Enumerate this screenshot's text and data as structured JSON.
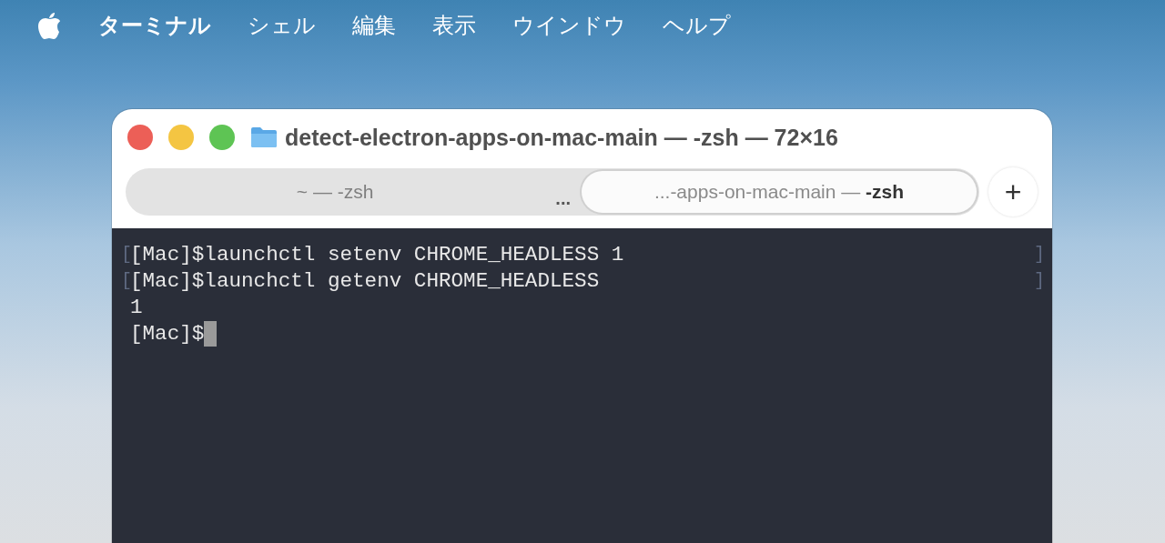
{
  "menu_bar": {
    "items": [
      {
        "label": "ターミナル",
        "bold": true
      },
      {
        "label": "シェル",
        "bold": false
      },
      {
        "label": "編集",
        "bold": false
      },
      {
        "label": "表示",
        "bold": false
      },
      {
        "label": "ウインドウ",
        "bold": false
      },
      {
        "label": "ヘルプ",
        "bold": false
      }
    ]
  },
  "window": {
    "title": "detect-electron-apps-on-mac-main — -zsh — 72×16",
    "tabs": [
      {
        "label": "~ — -zsh",
        "selected": false
      },
      {
        "label": "...-apps-on-mac-main — ",
        "bold_part": "-zsh",
        "selected": true
      }
    ],
    "tab_overflow": "...",
    "new_tab": "+"
  },
  "terminal": {
    "lines": [
      {
        "mark_left": "[",
        "text": "[Mac]$launchctl setenv CHROME_HEADLESS 1",
        "mark_right": "]",
        "cursor": false
      },
      {
        "mark_left": "[",
        "text": "[Mac]$launchctl getenv CHROME_HEADLESS",
        "mark_right": "]",
        "cursor": false
      },
      {
        "text": "1",
        "cursor": false
      },
      {
        "text": "[Mac]$",
        "cursor": true
      }
    ]
  }
}
